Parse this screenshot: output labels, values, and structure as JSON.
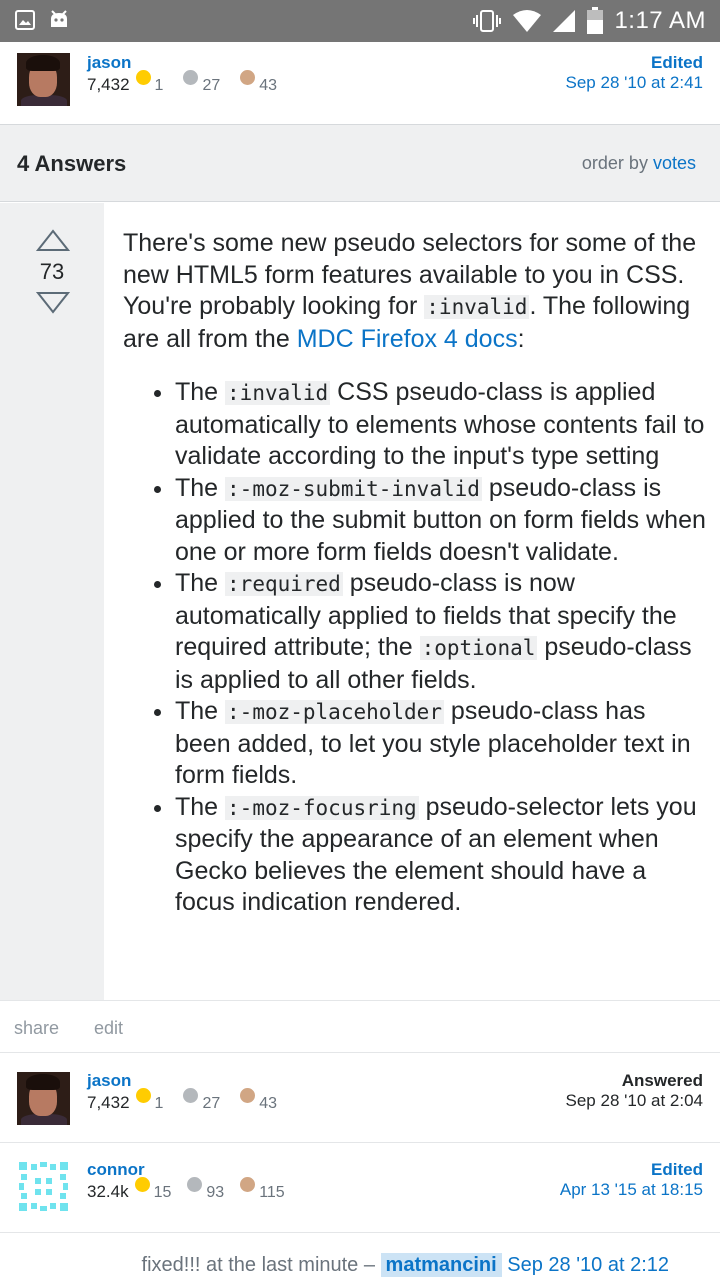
{
  "status_bar": {
    "time": "1:17 AM",
    "icons": [
      "gallery-icon",
      "android-debug-icon",
      "vibrate-icon",
      "wifi-icon",
      "signal-icon",
      "battery-icon"
    ]
  },
  "question_owner": {
    "name": "jason",
    "reputation": "7,432",
    "gold": "1",
    "silver": "27",
    "bronze": "43",
    "action": "Edited",
    "date": "Sep 28 '10 at 2:41"
  },
  "answers_header": {
    "count": "4 Answers",
    "order_label": "order by",
    "order_value": "votes"
  },
  "answer": {
    "votes": "73",
    "intro": {
      "t1": "There's some new pseudo selectors for some of the new HTML5 form features available to you in CSS. You're probably looking for ",
      "c1": ":invalid",
      "t2": ". The following are all from the ",
      "link": "MDC Firefox 4 docs",
      "t3": ":"
    },
    "items": [
      {
        "pre": "The ",
        "code": ":invalid",
        "post": " CSS pseudo-class is applied automatically to elements whose contents fail to validate according to the input's type setting"
      },
      {
        "pre": "The ",
        "code": ":-moz-submit-invalid",
        "post": " pseudo-class is applied to the submit button on form fields when one or more form fields doesn't validate."
      },
      {
        "pre": "The ",
        "code": ":required",
        "post": " pseudo-class is now automatically applied to fields that specify the required attribute; the ",
        "code2": ":optional",
        "post2": " pseudo-class is applied to all other fields."
      },
      {
        "pre": "The ",
        "code": ":-moz-placeholder",
        "post": " pseudo-class has been added, to let you style placeholder text in form fields."
      },
      {
        "pre": "The ",
        "code": ":-moz-focusring",
        "post": " pseudo-selector lets you specify the appearance of an element when Gecko believes the element should have a focus indication rendered."
      }
    ],
    "share_label": "share",
    "edit_label": "edit"
  },
  "answer_owner": {
    "name": "jason",
    "reputation": "7,432",
    "gold": "1",
    "silver": "27",
    "bronze": "43",
    "action": "Answered",
    "date": "Sep 28 '10 at 2:04"
  },
  "answer_editor": {
    "name": "connor",
    "reputation": "32.4k",
    "gold": "15",
    "silver": "93",
    "bronze": "115",
    "action": "Edited",
    "date": "Apr 13 '15 at 18:15"
  },
  "comment": {
    "text": "fixed!!! at the last minute – ",
    "user": "matmancini",
    "date": "Sep 28 '10 at 2:12"
  },
  "colors": {
    "link": "#0b74c7",
    "gold": "#ffcc01",
    "silver": "#b4b8bc",
    "bronze": "#d1a684",
    "status_bar": "#757575"
  }
}
